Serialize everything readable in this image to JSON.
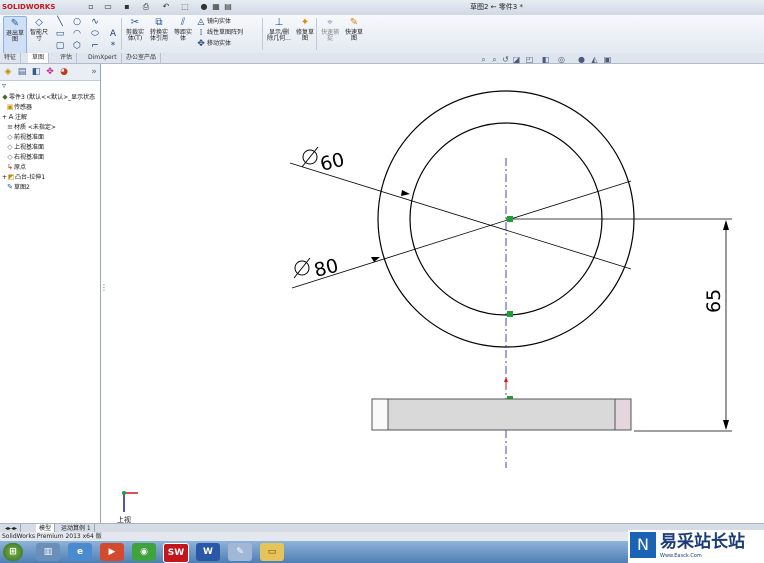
{
  "app": {
    "logo_text": "SOLIDWORKS",
    "document_title": "草图2 ← 零件3 *",
    "version_status": "SolidWorks Premium 2013 x64 版"
  },
  "ribbon": {
    "buttons": [
      {
        "id": "exit-sketch",
        "label": "退出草图",
        "icon": "sketch-icon"
      },
      {
        "id": "smart-dimension",
        "label": "智能尺寸",
        "icon": "dimension-icon"
      },
      {
        "id": "trim-entities",
        "label": "剪裁实体(T)",
        "icon": "trim-icon"
      },
      {
        "id": "convert-entities",
        "label": "转换实体引用",
        "icon": "convert-icon"
      },
      {
        "id": "offset-entities",
        "label": "等距实体",
        "icon": "offset-icon"
      },
      {
        "id": "display-relations",
        "label": "显示/删除几何...",
        "icon": "relations-icon"
      },
      {
        "id": "repair-sketch",
        "label": "修复草图",
        "icon": "repair-icon"
      },
      {
        "id": "quick-snaps",
        "label": "快速捕捉",
        "icon": "snap-icon"
      },
      {
        "id": "rapid-sketch",
        "label": "快速草图",
        "icon": "rapid-sketch-icon"
      }
    ],
    "small_labels": [
      "镜向实体",
      "线性草图阵列",
      "移动实体"
    ]
  },
  "command_tabs": [
    "特征",
    "草图",
    "评估",
    "DimXpert",
    "办公室产品"
  ],
  "active_command_tab": "草图",
  "tree": {
    "items": [
      {
        "label": "零件3 (默认<<默认>_显示状态",
        "icon": "part-icon",
        "indent": 0
      },
      {
        "label": "传感器",
        "icon": "sensor-icon",
        "indent": 1
      },
      {
        "label": "注解",
        "icon": "annotation-icon",
        "indent": 1
      },
      {
        "label": "材质 <未指定>",
        "icon": "material-icon",
        "indent": 1
      },
      {
        "label": "前视基准面",
        "icon": "plane-icon",
        "indent": 1
      },
      {
        "label": "上视基准面",
        "icon": "plane-icon",
        "indent": 1
      },
      {
        "label": "右视基准面",
        "icon": "plane-icon",
        "indent": 1
      },
      {
        "label": "原点",
        "icon": "origin-icon",
        "indent": 1
      },
      {
        "label": "凸台-拉伸1",
        "icon": "extrude-icon",
        "indent": 1
      },
      {
        "label": "草图2",
        "icon": "sketch-icon",
        "indent": 1
      }
    ]
  },
  "drawing": {
    "dim_inner": "60",
    "dim_outer": "80",
    "dim_vertical": "65",
    "view_label": "上视"
  },
  "bottom_tabs": [
    "模型",
    "运动算例 1"
  ],
  "taskbar": {
    "apps": [
      "start",
      "explorer",
      "ie",
      "media",
      "360",
      "solidworks",
      "word",
      "paint",
      "folder"
    ]
  },
  "watermark": {
    "text": "易采站长站",
    "url": "Www.Easck.Com"
  },
  "colors": {
    "sketch_line": "#000000",
    "centerline": "#1a1aa0",
    "relation_marker": "#1fa12e",
    "origin_red": "#d01818",
    "part_fill": "#d9d9d9"
  }
}
